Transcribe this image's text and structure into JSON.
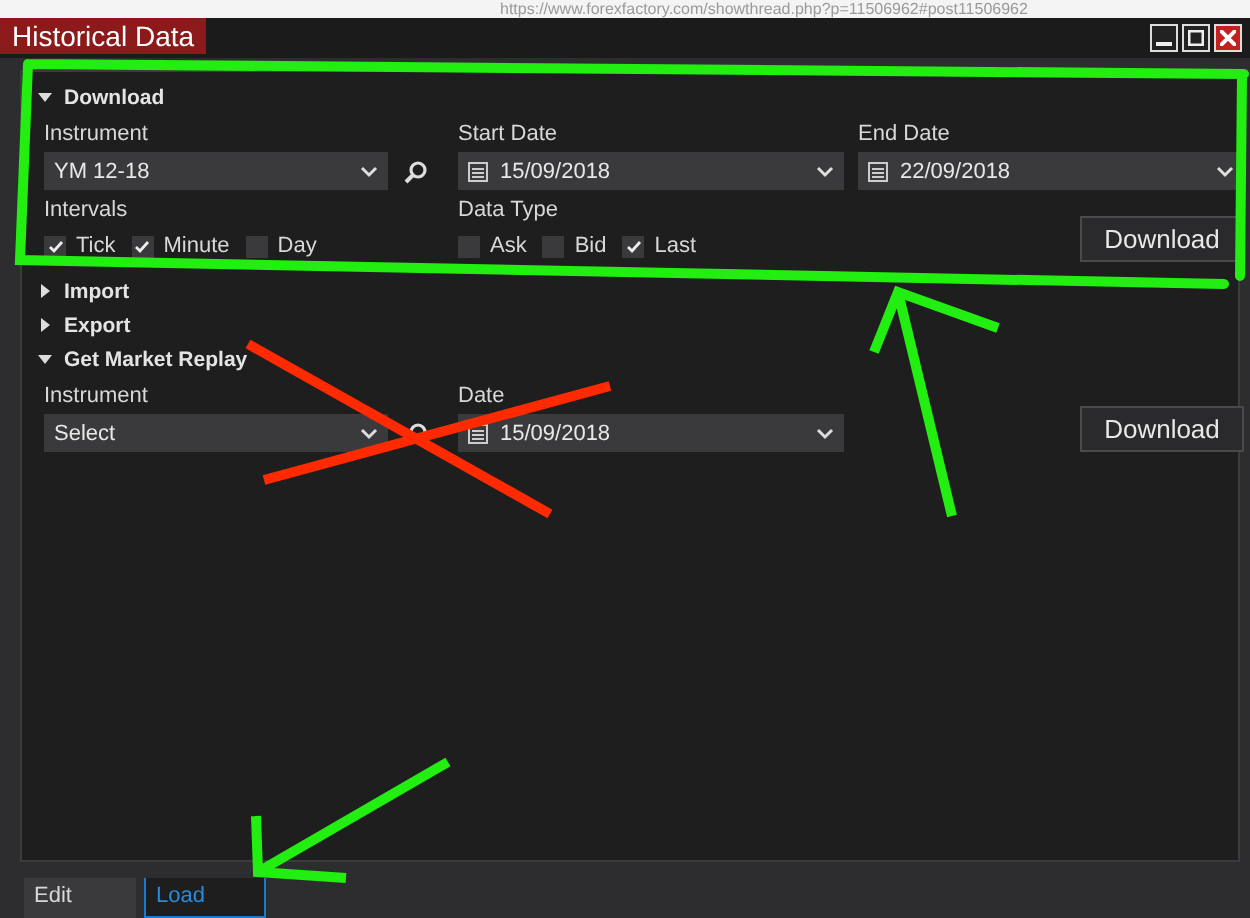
{
  "browser": {
    "url": "https://www.forexfactory.com/showthread.php?p=11506962#post11506962"
  },
  "window": {
    "title": "Historical Data"
  },
  "sections": [
    {
      "title": "Download",
      "expanded": true,
      "fields": [
        {
          "kind": "instrument",
          "label": "Instrument",
          "value": "YM 12-18"
        },
        {
          "kind": "date",
          "label": "Start Date",
          "value": "15/09/2018"
        },
        {
          "kind": "date",
          "label": "End Date",
          "value": "22/09/2018"
        }
      ],
      "groups": [
        {
          "label": "Intervals",
          "options": [
            {
              "label": "Tick",
              "checked": true
            },
            {
              "label": "Minute",
              "checked": true
            },
            {
              "label": "Day",
              "checked": false
            }
          ]
        },
        {
          "label": "Data Type",
          "options": [
            {
              "label": "Ask",
              "checked": false
            },
            {
              "label": "Bid",
              "checked": false
            },
            {
              "label": "Last",
              "checked": true
            }
          ]
        }
      ],
      "button": "Download"
    },
    {
      "title": "Import",
      "expanded": false
    },
    {
      "title": "Export",
      "expanded": false
    },
    {
      "title": "Get Market Replay",
      "expanded": true,
      "fields": [
        {
          "kind": "instrument",
          "label": "Instrument",
          "value": "Select"
        },
        {
          "kind": "date",
          "label": "Date",
          "value": "15/09/2018"
        }
      ],
      "button": "Download"
    }
  ],
  "bottom_tabs": [
    {
      "label": "Edit",
      "selected": false
    },
    {
      "label": "Load",
      "selected": true
    }
  ]
}
